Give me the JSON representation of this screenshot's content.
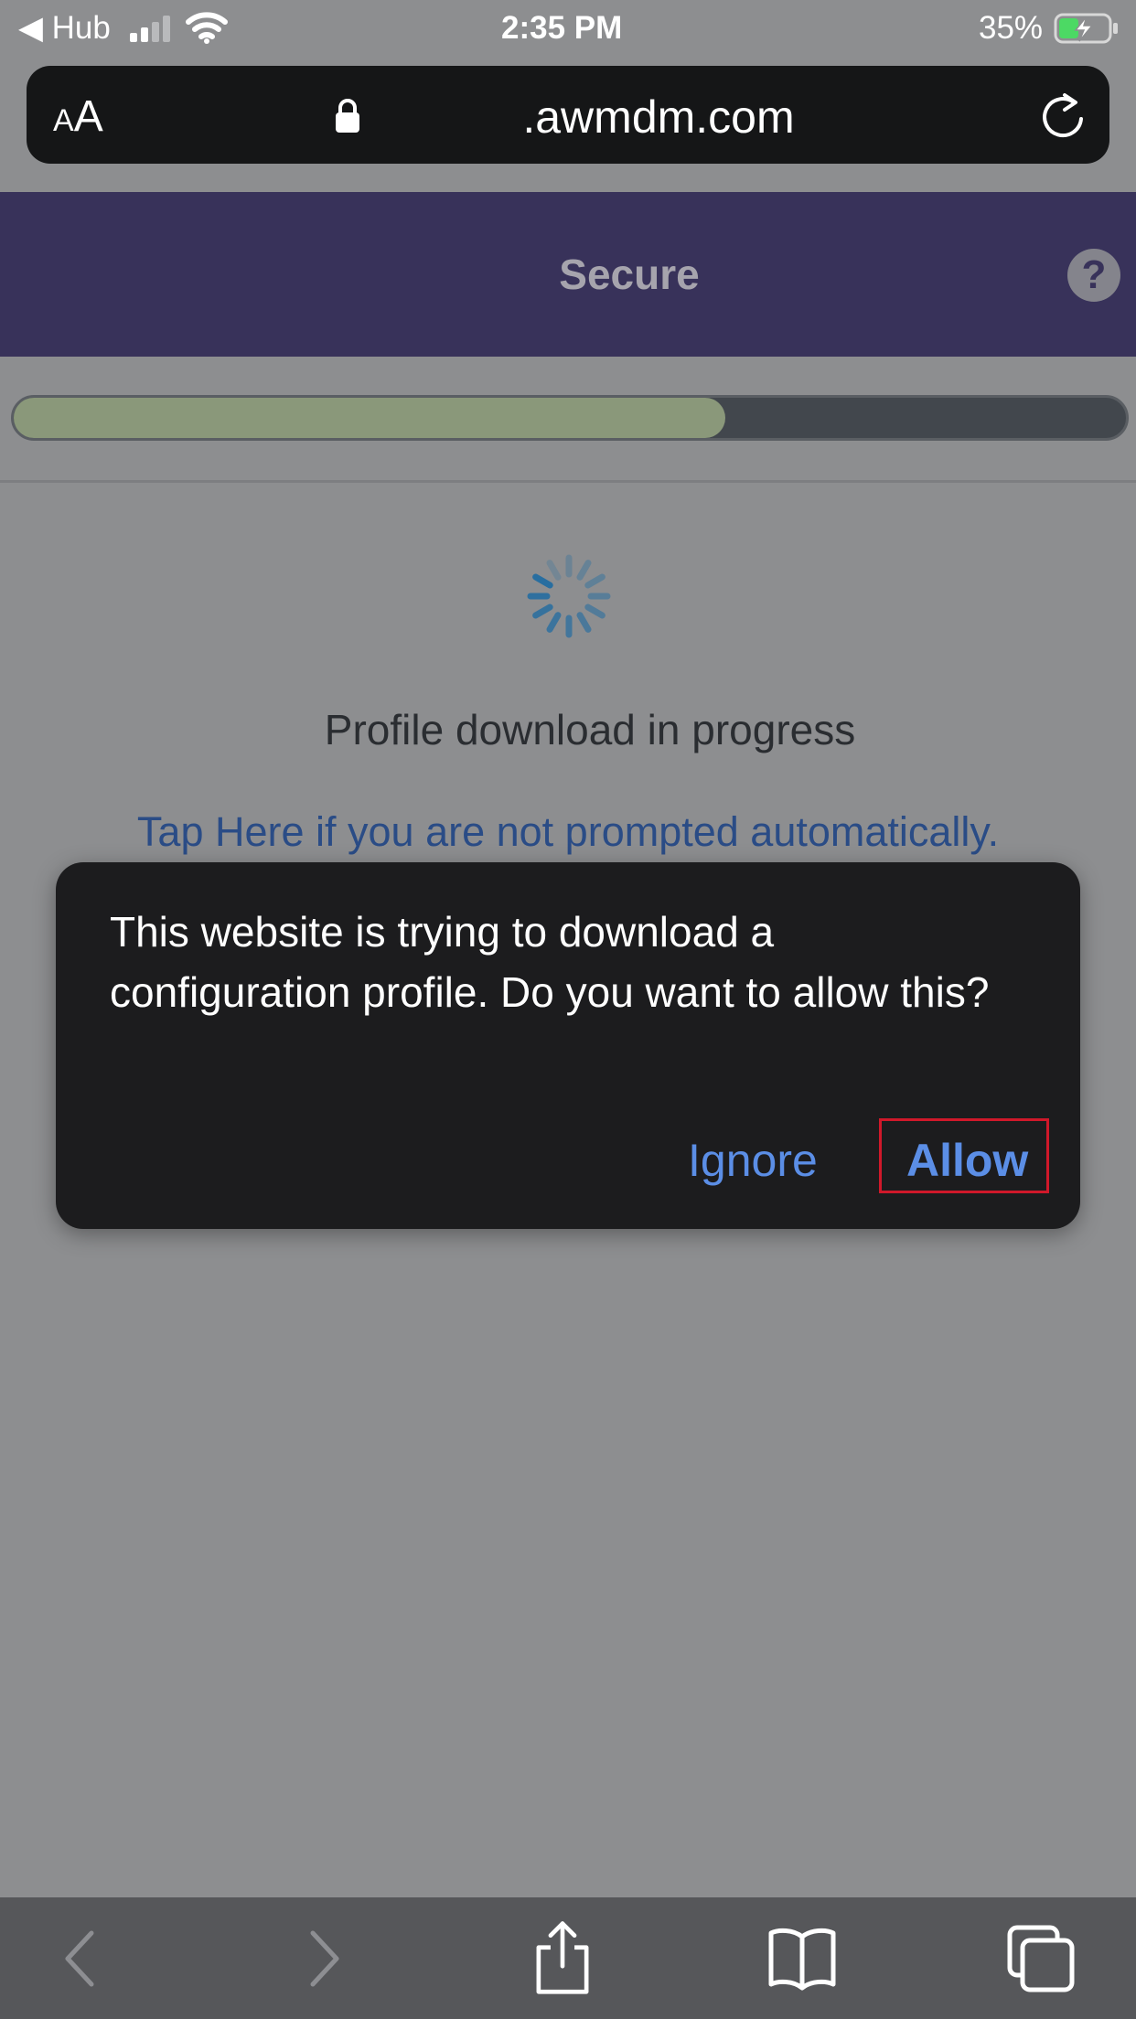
{
  "status_bar": {
    "back_app": "◀ Hub",
    "time": "2:35 PM",
    "battery": "35%",
    "icons": [
      "cellular-signal-icon",
      "wifi-icon",
      "battery-charging-icon"
    ]
  },
  "address_bar": {
    "text_size_label_small": "A",
    "text_size_label_large": "A",
    "domain": ".awmdm.com",
    "icons": [
      "lock-icon",
      "reload-icon"
    ]
  },
  "header": {
    "title": "Secure",
    "help_label": "?",
    "color": "#38325a"
  },
  "progress": {
    "fraction": 0.64,
    "fill_color": "#8a987a"
  },
  "content": {
    "status_text": "Profile download in progress",
    "manual_link": "Tap Here if you are not prompted automatically."
  },
  "dialog": {
    "message": "This website is trying to download a configuration profile. Do you want to allow this?",
    "ignore_label": "Ignore",
    "allow_label": "Allow",
    "highlight_color": "#d0182a"
  },
  "toolbar": {
    "icons": [
      "back-chevron-icon",
      "forward-chevron-icon",
      "share-icon",
      "bookmarks-icon",
      "tabs-icon"
    ]
  }
}
